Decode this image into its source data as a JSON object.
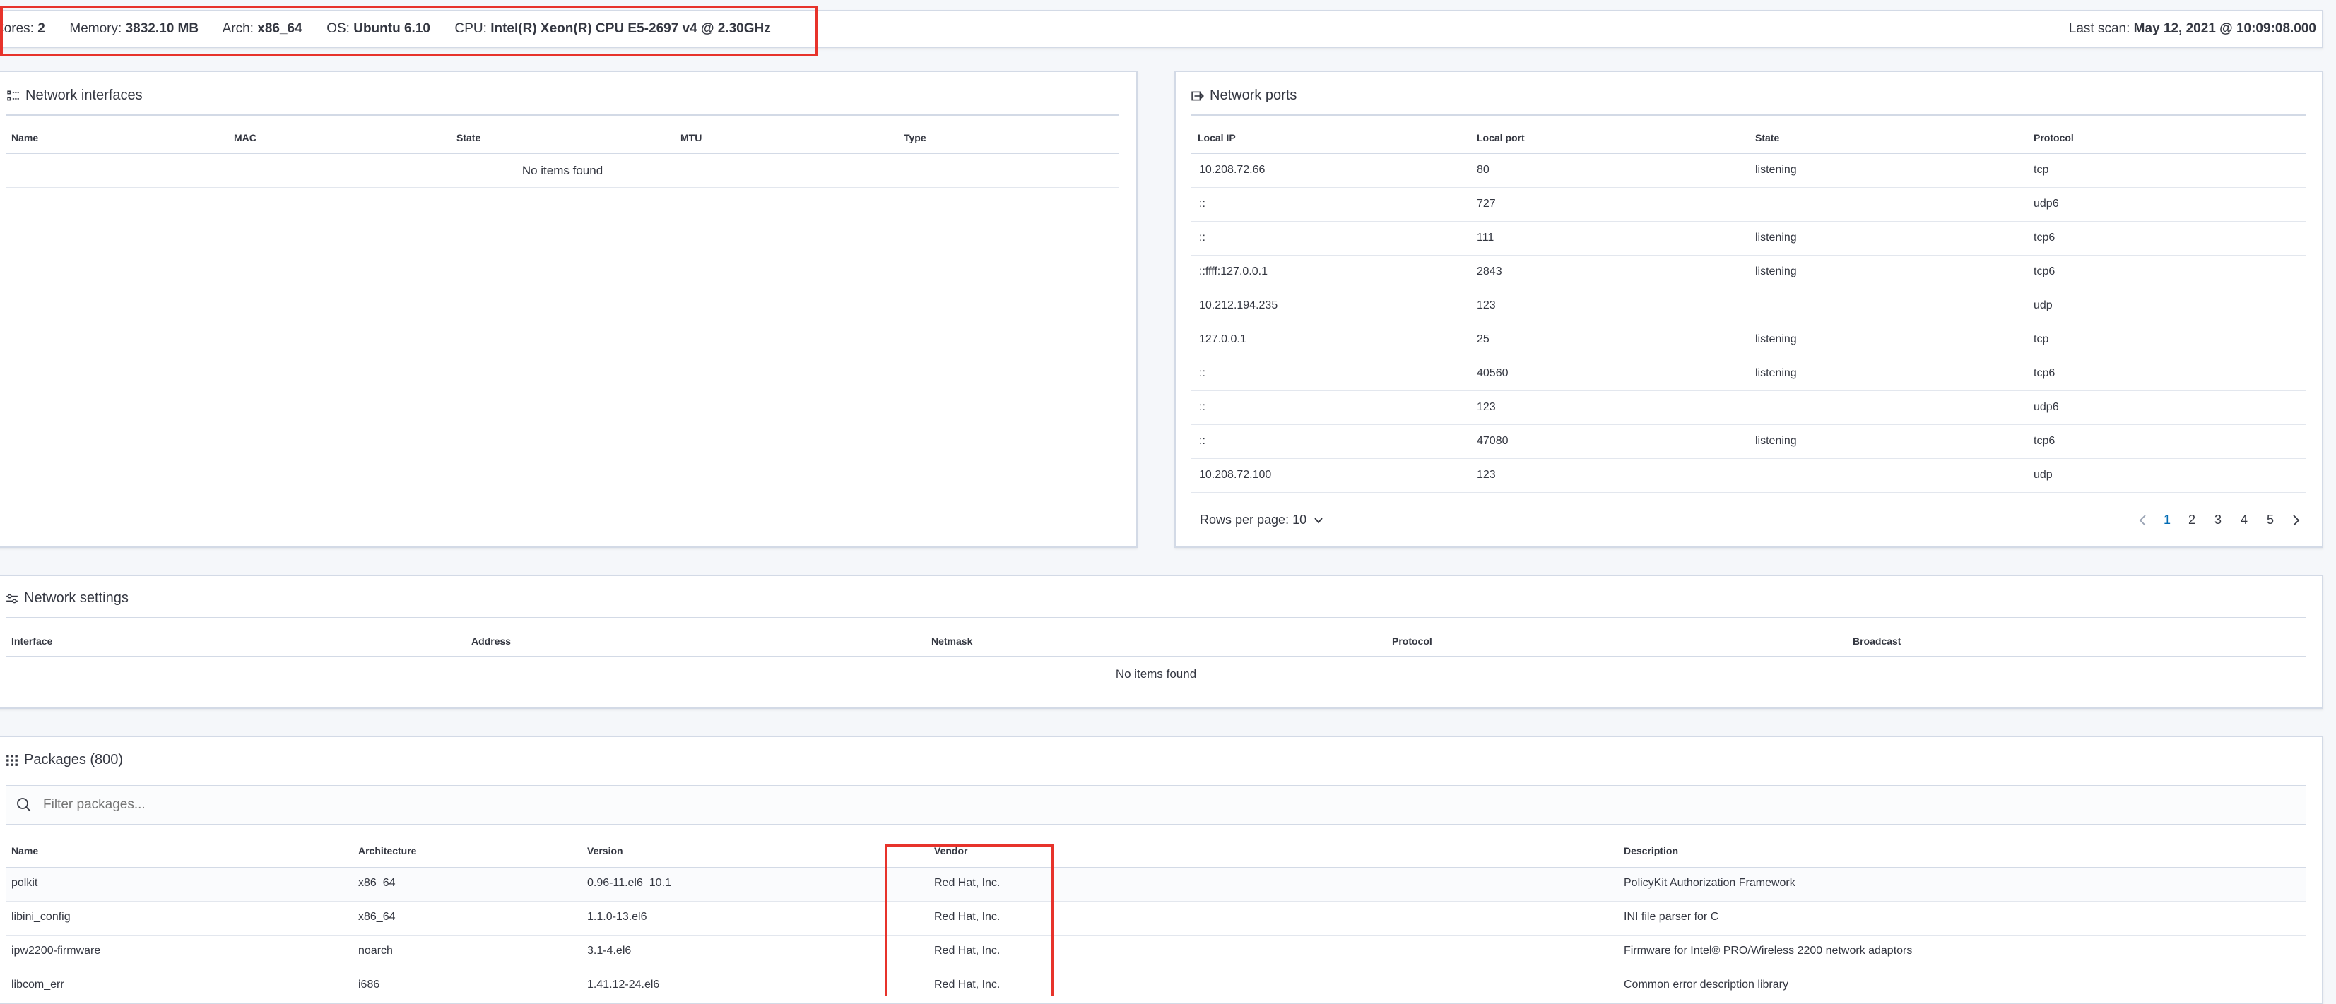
{
  "summary": {
    "cores_label": "Cores:",
    "cores_value": "2",
    "memory_label": "Memory:",
    "memory_value": "3832.10 MB",
    "arch_label": "Arch:",
    "arch_value": "x86_64",
    "os_label": "OS:",
    "os_value": "Ubuntu 6.10",
    "cpu_label": "CPU:",
    "cpu_value": "Intel(R) Xeon(R) CPU E5-2697 v4 @ 2.30GHz",
    "last_scan_label": "Last scan:",
    "last_scan_value": "May 12, 2021 @ 10:09:08.000"
  },
  "interfaces": {
    "title": "Network interfaces",
    "columns": [
      "Name",
      "MAC",
      "State",
      "MTU",
      "Type"
    ],
    "empty": "No items found"
  },
  "ports": {
    "title": "Network ports",
    "columns": [
      "Local IP",
      "Local port",
      "State",
      "Protocol"
    ],
    "rows": [
      [
        "10.208.72.66",
        "80",
        "listening",
        "tcp"
      ],
      [
        "::",
        "727",
        "",
        "udp6"
      ],
      [
        "::",
        "111",
        "listening",
        "tcp6"
      ],
      [
        "::ffff:127.0.0.1",
        "2843",
        "listening",
        "tcp6"
      ],
      [
        "10.212.194.235",
        "123",
        "",
        "udp"
      ],
      [
        "127.0.0.1",
        "25",
        "listening",
        "tcp"
      ],
      [
        "::",
        "40560",
        "listening",
        "tcp6"
      ],
      [
        "::",
        "123",
        "",
        "udp6"
      ],
      [
        "::",
        "47080",
        "listening",
        "tcp6"
      ],
      [
        "10.208.72.100",
        "123",
        "",
        "udp"
      ]
    ],
    "rows_per_page": "Rows per page: 10",
    "pages": [
      "1",
      "2",
      "3",
      "4",
      "5"
    ],
    "current_page": "1"
  },
  "settings": {
    "title": "Network settings",
    "columns": [
      "Interface",
      "Address",
      "Netmask",
      "Protocol",
      "Broadcast"
    ],
    "empty": "No items found"
  },
  "packages": {
    "title": "Packages (800)",
    "search_placeholder": "Filter packages...",
    "columns": [
      "Name",
      "Architecture",
      "Version",
      "Vendor",
      "Description"
    ],
    "rows": [
      [
        "polkit",
        "x86_64",
        "0.96-11.el6_10.1",
        "Red Hat, Inc.",
        "PolicyKit Authorization Framework"
      ],
      [
        "libini_config",
        "x86_64",
        "1.1.0-13.el6",
        "Red Hat, Inc.",
        "INI file parser for C"
      ],
      [
        "ipw2200-firmware",
        "noarch",
        "3.1-4.el6",
        "Red Hat, Inc.",
        "Firmware for Intel® PRO/Wireless 2200 network adaptors"
      ],
      [
        "libcom_err",
        "i686",
        "1.41.12-24.el6",
        "Red Hat, Inc.",
        "Common error description library"
      ]
    ]
  },
  "colors": {
    "accent": "#006bb4",
    "highlight": "#e7332b",
    "border": "#d3dae6"
  }
}
